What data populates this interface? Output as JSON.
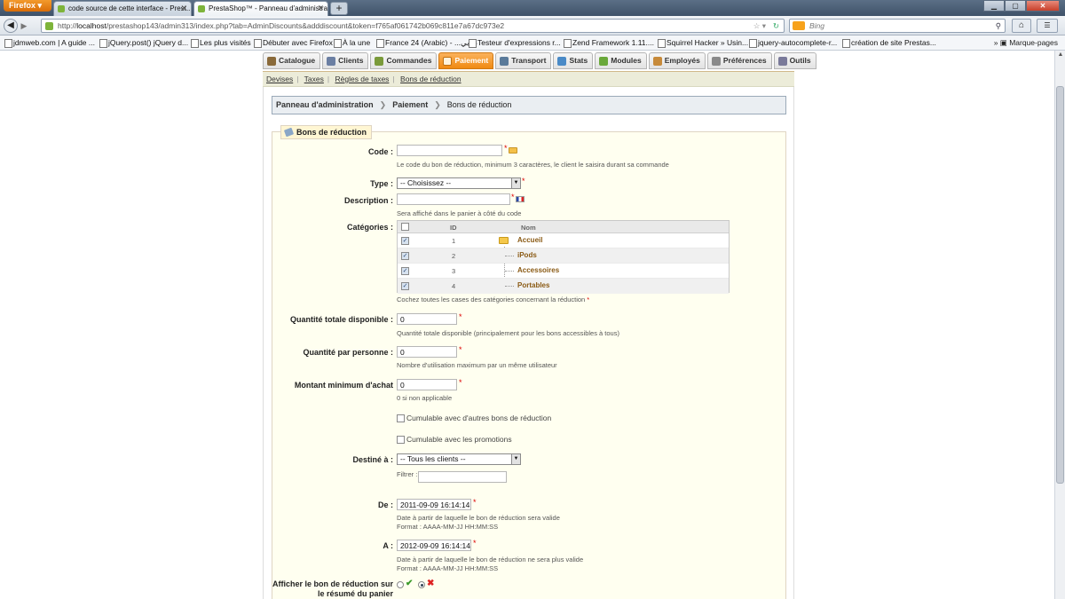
{
  "browser": {
    "app_button": "Firefox",
    "tabs": [
      {
        "label": "code source de cette interface - Prest..."
      },
      {
        "label": "PrestaShop™ - Panneau d'administra..."
      }
    ],
    "url_prefix": "http://",
    "url_host": "localhost",
    "url_rest": "/prestashop143/admin313/index.php?tab=AdminDiscounts&adddiscount&token=f765af061742b069c811e7a67dc973e2",
    "search_placeholder": "Bing",
    "bookmarks": [
      "jdmweb.com | A guide ...",
      "jQuery.post() jQuery d...",
      "Les plus visités",
      "Débuter avec Firefox",
      "À la une",
      "France 24 (Arabic) - ...عربي",
      "Testeur d'expressions r...",
      "Zend Framework 1.11....",
      "Squirrel Hacker » Usin...",
      "jquery-autocomplete-r...",
      "création de site Prestas..."
    ],
    "bookmarks_menu": "Marque-pages"
  },
  "admin_tabs": [
    {
      "label": "Catalogue",
      "color": "#8a6a3a"
    },
    {
      "label": "Clients",
      "color": "#6b7fa3"
    },
    {
      "label": "Commandes",
      "color": "#7a9a3a"
    },
    {
      "label": "Paiement",
      "color": "#ffffff"
    },
    {
      "label": "Transport",
      "color": "#5a7a9a"
    },
    {
      "label": "Stats",
      "color": "#4a8ac7"
    },
    {
      "label": "Modules",
      "color": "#6aa83a"
    },
    {
      "label": "Employés",
      "color": "#c78a3a"
    },
    {
      "label": "Préférences",
      "color": "#8a8a8a"
    },
    {
      "label": "Outils",
      "color": "#7a7a9a"
    }
  ],
  "subnav": [
    "Devises",
    "Taxes",
    "Règles de taxes",
    "Bons de réduction"
  ],
  "breadcrumb": {
    "root": "Panneau d'administration",
    "section": "Paiement",
    "page": "Bons de réduction"
  },
  "form": {
    "legend": "Bons de réduction",
    "code": {
      "label": "Code :",
      "value": "",
      "hint": "Le code du bon de réduction, minimum 3 caractères, le client le saisira durant sa commande"
    },
    "type": {
      "label": "Type :",
      "value": "-- Choisissez --"
    },
    "description": {
      "label": "Description :",
      "value": "",
      "hint": "Sera affiché dans le panier à côté du code"
    },
    "categories": {
      "label": "Catégories :",
      "col_id": "ID",
      "col_name": "Nom",
      "rows": [
        {
          "id": "1",
          "name": "Accueil",
          "checked": true
        },
        {
          "id": "2",
          "name": "iPods",
          "checked": true
        },
        {
          "id": "3",
          "name": "Accessoires",
          "checked": true
        },
        {
          "id": "4",
          "name": "Portables",
          "checked": true
        }
      ],
      "hint": "Cochez toutes les cases des catégories concernant la réduction"
    },
    "quantity_total": {
      "label": "Quantité totale disponible :",
      "value": "0",
      "hint": "Quantité totale disponible (principalement pour les bons accessibles à tous)"
    },
    "quantity_per_user": {
      "label": "Quantité par personne :",
      "value": "0",
      "hint": "Nombre d'utilisation maximum par un même utilisateur"
    },
    "minimum_amount": {
      "label": "Montant minimum d'achat",
      "value": "0",
      "hint": "0 si non applicable"
    },
    "cumulable_vouchers": {
      "label": "Cumulable avec d'autres bons de réduction",
      "checked": false
    },
    "cumulable_promotions": {
      "label": "Cumulable avec les promotions",
      "checked": false
    },
    "customer": {
      "label": "Destiné à :",
      "value": "-- Tous les clients --",
      "filter_label": "Filtrer :",
      "filter_value": ""
    },
    "date_from": {
      "label": "De :",
      "value": "2011-09-09 16:14:14",
      "hint1": "Date à partir de laquelle le bon de réduction sera valide",
      "hint2": "Format : AAAA-MM-JJ HH:MM:SS"
    },
    "date_to": {
      "label": "A :",
      "value": "2012-09-09 16:14:14",
      "hint1": "Date à partir de laquelle le bon de réduction ne sera plus valide",
      "hint2": "Format : AAAA-MM-JJ HH:MM:SS"
    },
    "show_in_cart": {
      "label_line1": "Afficher le bon de réduction sur",
      "label_line2": "le résumé du panier"
    }
  }
}
